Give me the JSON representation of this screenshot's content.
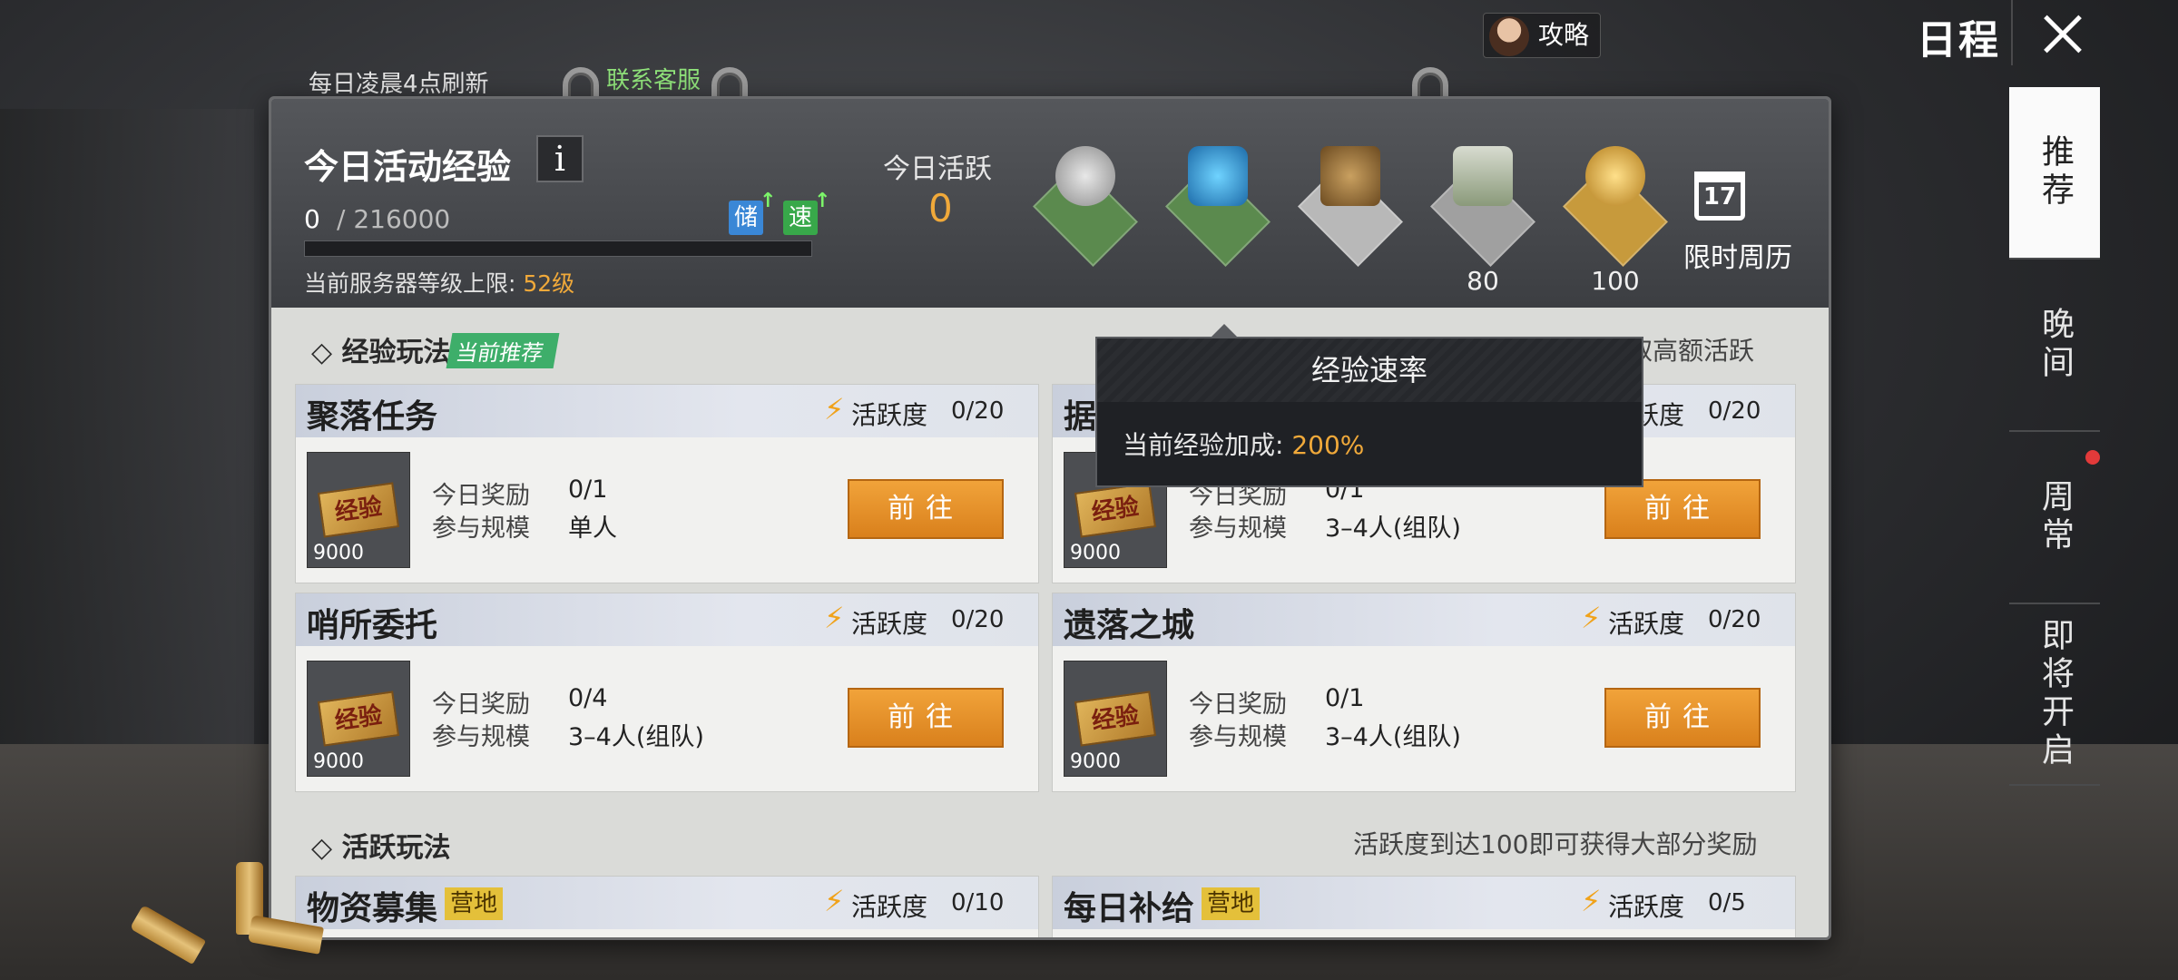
{
  "topbar": {
    "refresh_note": "每日凌晨4点刷新",
    "contact_service": "联系客服",
    "guide_label": "攻略",
    "page_title": "日程"
  },
  "header": {
    "exp_title": "今日活动经验",
    "info_symbol": "i",
    "exp_current": "0",
    "exp_max": "/ 216000",
    "exp_progress": 0,
    "boost_store": "储",
    "boost_speed": "速",
    "server_limit_prefix": "当前服务器等级上限: ",
    "server_limit_value": "52级",
    "daily_active_label": "今日活跃",
    "daily_active_value": "0",
    "reward_tiers": [
      {
        "icon": "silver-coin-crate",
        "value": ""
      },
      {
        "icon": "energy-crate",
        "value": ""
      },
      {
        "icon": "emblem-crate",
        "value": ""
      },
      {
        "icon": "ammo-crate",
        "value": "80"
      },
      {
        "icon": "gold-coin-crate",
        "value": "100"
      }
    ],
    "calendar_day": "17",
    "calendar_label": "限时周历"
  },
  "tooltip": {
    "title": "经验速率",
    "body_prefix": "当前经验加成: ",
    "body_value": "200%"
  },
  "sections": {
    "exp": {
      "title": "◇ 经验玩法",
      "tag": "当前推荐",
      "note": "满每日经验上限，并获取高额活跃"
    },
    "active": {
      "title": "◇ 活跃玩法",
      "note": "活跃度到达100即可获得大部分奖励"
    }
  },
  "labels": {
    "activity": "活跃度",
    "today_reward": "今日奖励",
    "scale": "参与规模",
    "go": "前往",
    "camp": "营地",
    "exp_ticket": "经验"
  },
  "activities": [
    {
      "name": "聚落任务",
      "activity": "0/20",
      "reward": "0/1",
      "scale": "单人",
      "thumb_value": "9000"
    },
    {
      "name": "据点巡逻",
      "activity": "0/20",
      "reward": "0/1",
      "scale": "3–4人(组队)",
      "thumb_value": "9000"
    },
    {
      "name": "哨所委托",
      "activity": "0/20",
      "reward": "0/4",
      "scale": "3–4人(组队)",
      "thumb_value": "9000"
    },
    {
      "name": "遗落之城",
      "activity": "0/20",
      "reward": "0/1",
      "scale": "3–4人(组队)",
      "thumb_value": "9000"
    }
  ],
  "active_activities": [
    {
      "name": "物资募集",
      "activity": "0/10"
    },
    {
      "name": "每日补给",
      "activity": "0/5"
    }
  ],
  "side_nav": [
    {
      "label": "推荐",
      "active": true
    },
    {
      "label": "晚间",
      "active": false
    },
    {
      "label": "周常",
      "active": false,
      "badge": true
    },
    {
      "label": "即将开启",
      "active": false
    }
  ],
  "colors": {
    "accent_orange": "#f0a93a",
    "button_orange": "#e28d24",
    "green_tag": "#3eae6a",
    "camp_tag": "#e4c03a"
  }
}
